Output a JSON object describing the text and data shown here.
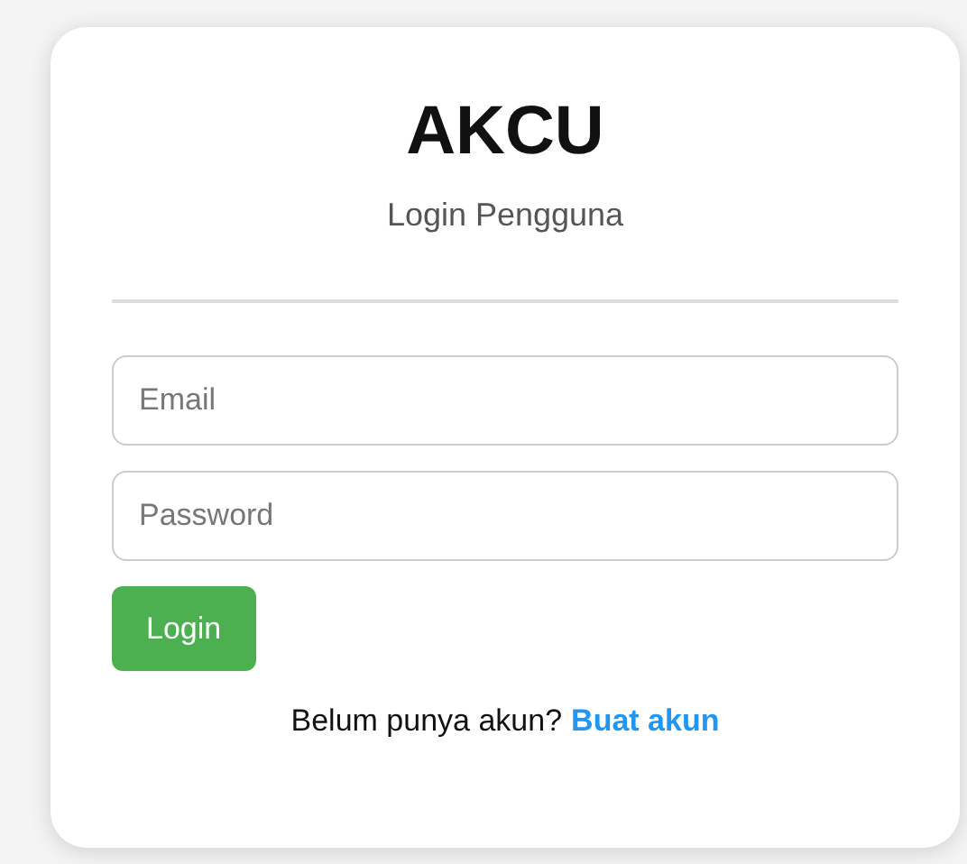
{
  "title": "AKCU",
  "subtitle": "Login Pengguna",
  "fields": [
    {
      "placeholder": "Email"
    },
    {
      "placeholder": "Password"
    }
  ],
  "button": "Login",
  "footer": {
    "text": "Belum punya akun?",
    "link": "Buat akun"
  }
}
